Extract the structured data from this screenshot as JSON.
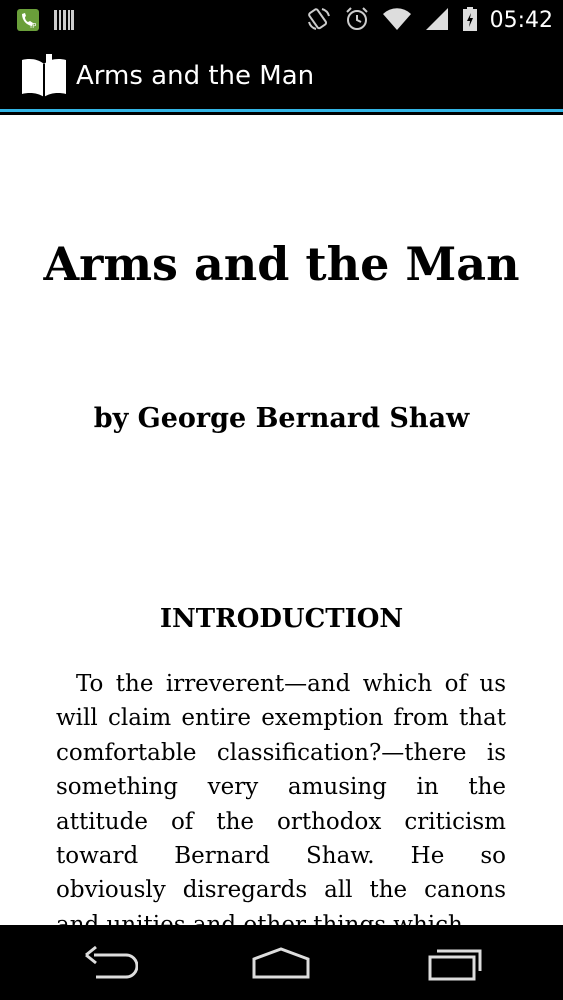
{
  "status_bar": {
    "time": "05:42",
    "icons": [
      "call-ip-icon",
      "barcode-icon",
      "rotate-icon",
      "alarm-icon",
      "wifi-icon",
      "signal-icon",
      "battery-icon"
    ]
  },
  "action_bar": {
    "app_icon": "book-icon",
    "title": "Arms and the Man"
  },
  "book": {
    "title": "Arms and the Man",
    "author": "by George Bernard Shaw",
    "section_heading": "INTRODUCTION",
    "section_text": "To the irreverent—and which of us will claim entire exemption from that comfortable classification?—there is something very amusing in the attitude of the orthodox criticism toward Bernard Shaw. He so obviously disregards all the canons and unities and other things which"
  },
  "nav_bar": {
    "buttons": [
      "back-icon",
      "home-icon",
      "recent-apps-icon"
    ]
  },
  "colors": {
    "accent": "#33b5e5",
    "background": "#ffffff",
    "bars": "#000000"
  }
}
